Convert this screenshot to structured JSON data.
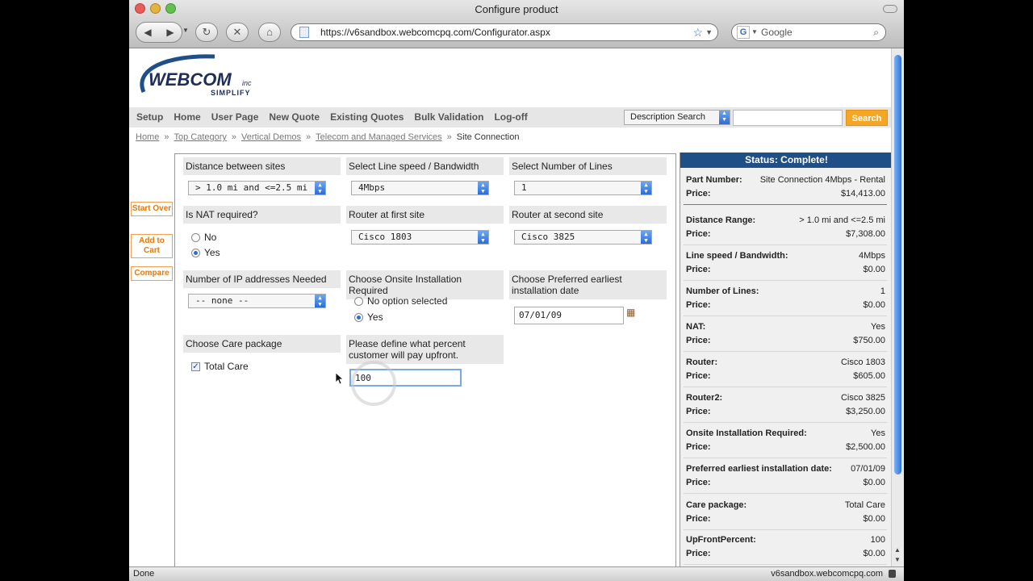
{
  "browser": {
    "title": "Configure product",
    "url": "https://v6sandbox.webcomcpq.com/Configurator.aspx",
    "search_placeholder": "Google",
    "status_left": "Done",
    "status_right": "v6sandbox.webcomcpq.com"
  },
  "logo": {
    "brand": "WEBCOM",
    "suffix": "inc",
    "tagline": "SIMPLIFY"
  },
  "menu": {
    "items": [
      "Setup",
      "Home",
      "User Page",
      "New Quote",
      "Existing Quotes",
      "Bulk Validation",
      "Log-off"
    ],
    "search_select": "Description Search",
    "search_button": "Search"
  },
  "breadcrumb": [
    "Home",
    "Top Category",
    "Vertical Demos",
    "Telecom and Managed Services",
    "Site Connection"
  ],
  "side_buttons": [
    "Start Over",
    "Add to Cart",
    "Compare"
  ],
  "form": {
    "distance": {
      "label": "Distance between sites",
      "value": "> 1.0 mi and <=2.5 mi"
    },
    "line_speed": {
      "label": "Select Line speed / Bandwidth",
      "value": "4Mbps"
    },
    "num_lines": {
      "label": "Select Number of Lines",
      "value": "1"
    },
    "nat": {
      "label": "Is NAT required?",
      "options": [
        "No",
        "Yes"
      ],
      "selected": "Yes"
    },
    "router1": {
      "label": "Router at first site",
      "value": "Cisco 1803"
    },
    "router2": {
      "label": "Router at second site",
      "value": "Cisco 3825"
    },
    "ip": {
      "label": "Number of IP addresses Needed",
      "value": "-- none --"
    },
    "onsite": {
      "label": "Choose Onsite Installation Required",
      "options": [
        "No option selected",
        "Yes"
      ],
      "selected": "Yes"
    },
    "install_date": {
      "label": "Choose Preferred earliest installation date",
      "value": "07/01/09"
    },
    "care": {
      "label": "Choose Care package",
      "option": "Total Care",
      "checked": true
    },
    "upfront": {
      "label": "Please define what percent customer will pay upfront.",
      "value": "100"
    }
  },
  "status": {
    "header": "Status: Complete!",
    "rows": [
      {
        "k": "Part Number:",
        "v": "Site Connection 4Mbps - Rental",
        "pk": "Price:",
        "pv": "$14,413.00"
      },
      {
        "k": "Distance Range:",
        "v": "> 1.0 mi and <=2.5 mi",
        "pk": "Price:",
        "pv": "$7,308.00"
      },
      {
        "k": "Line speed / Bandwidth:",
        "v": "4Mbps",
        "pk": "Price:",
        "pv": "$0.00"
      },
      {
        "k": "Number of Lines:",
        "v": "1",
        "pk": "Price:",
        "pv": "$0.00"
      },
      {
        "k": "NAT:",
        "v": "Yes",
        "pk": "Price:",
        "pv": "$750.00"
      },
      {
        "k": "Router:",
        "v": "Cisco 1803",
        "pk": "Price:",
        "pv": "$605.00"
      },
      {
        "k": "Router2:",
        "v": "Cisco 3825",
        "pk": "Price:",
        "pv": "$3,250.00"
      },
      {
        "k": "Onsite Installation Required:",
        "v": "Yes",
        "pk": "Price:",
        "pv": "$2,500.00"
      },
      {
        "k": "Preferred earliest installation date:",
        "v": "07/01/09",
        "pk": "Price:",
        "pv": "$0.00"
      },
      {
        "k": "Care package:",
        "v": "Total Care",
        "pk": "Price:",
        "pv": "$0.00"
      },
      {
        "k": "UpFrontPercent:",
        "v": "100",
        "pk": "Price:",
        "pv": "$0.00"
      }
    ]
  },
  "colors": {
    "accent_orange": "#f5a623",
    "status_header": "#1e4f86",
    "link_gray": "#777777"
  }
}
